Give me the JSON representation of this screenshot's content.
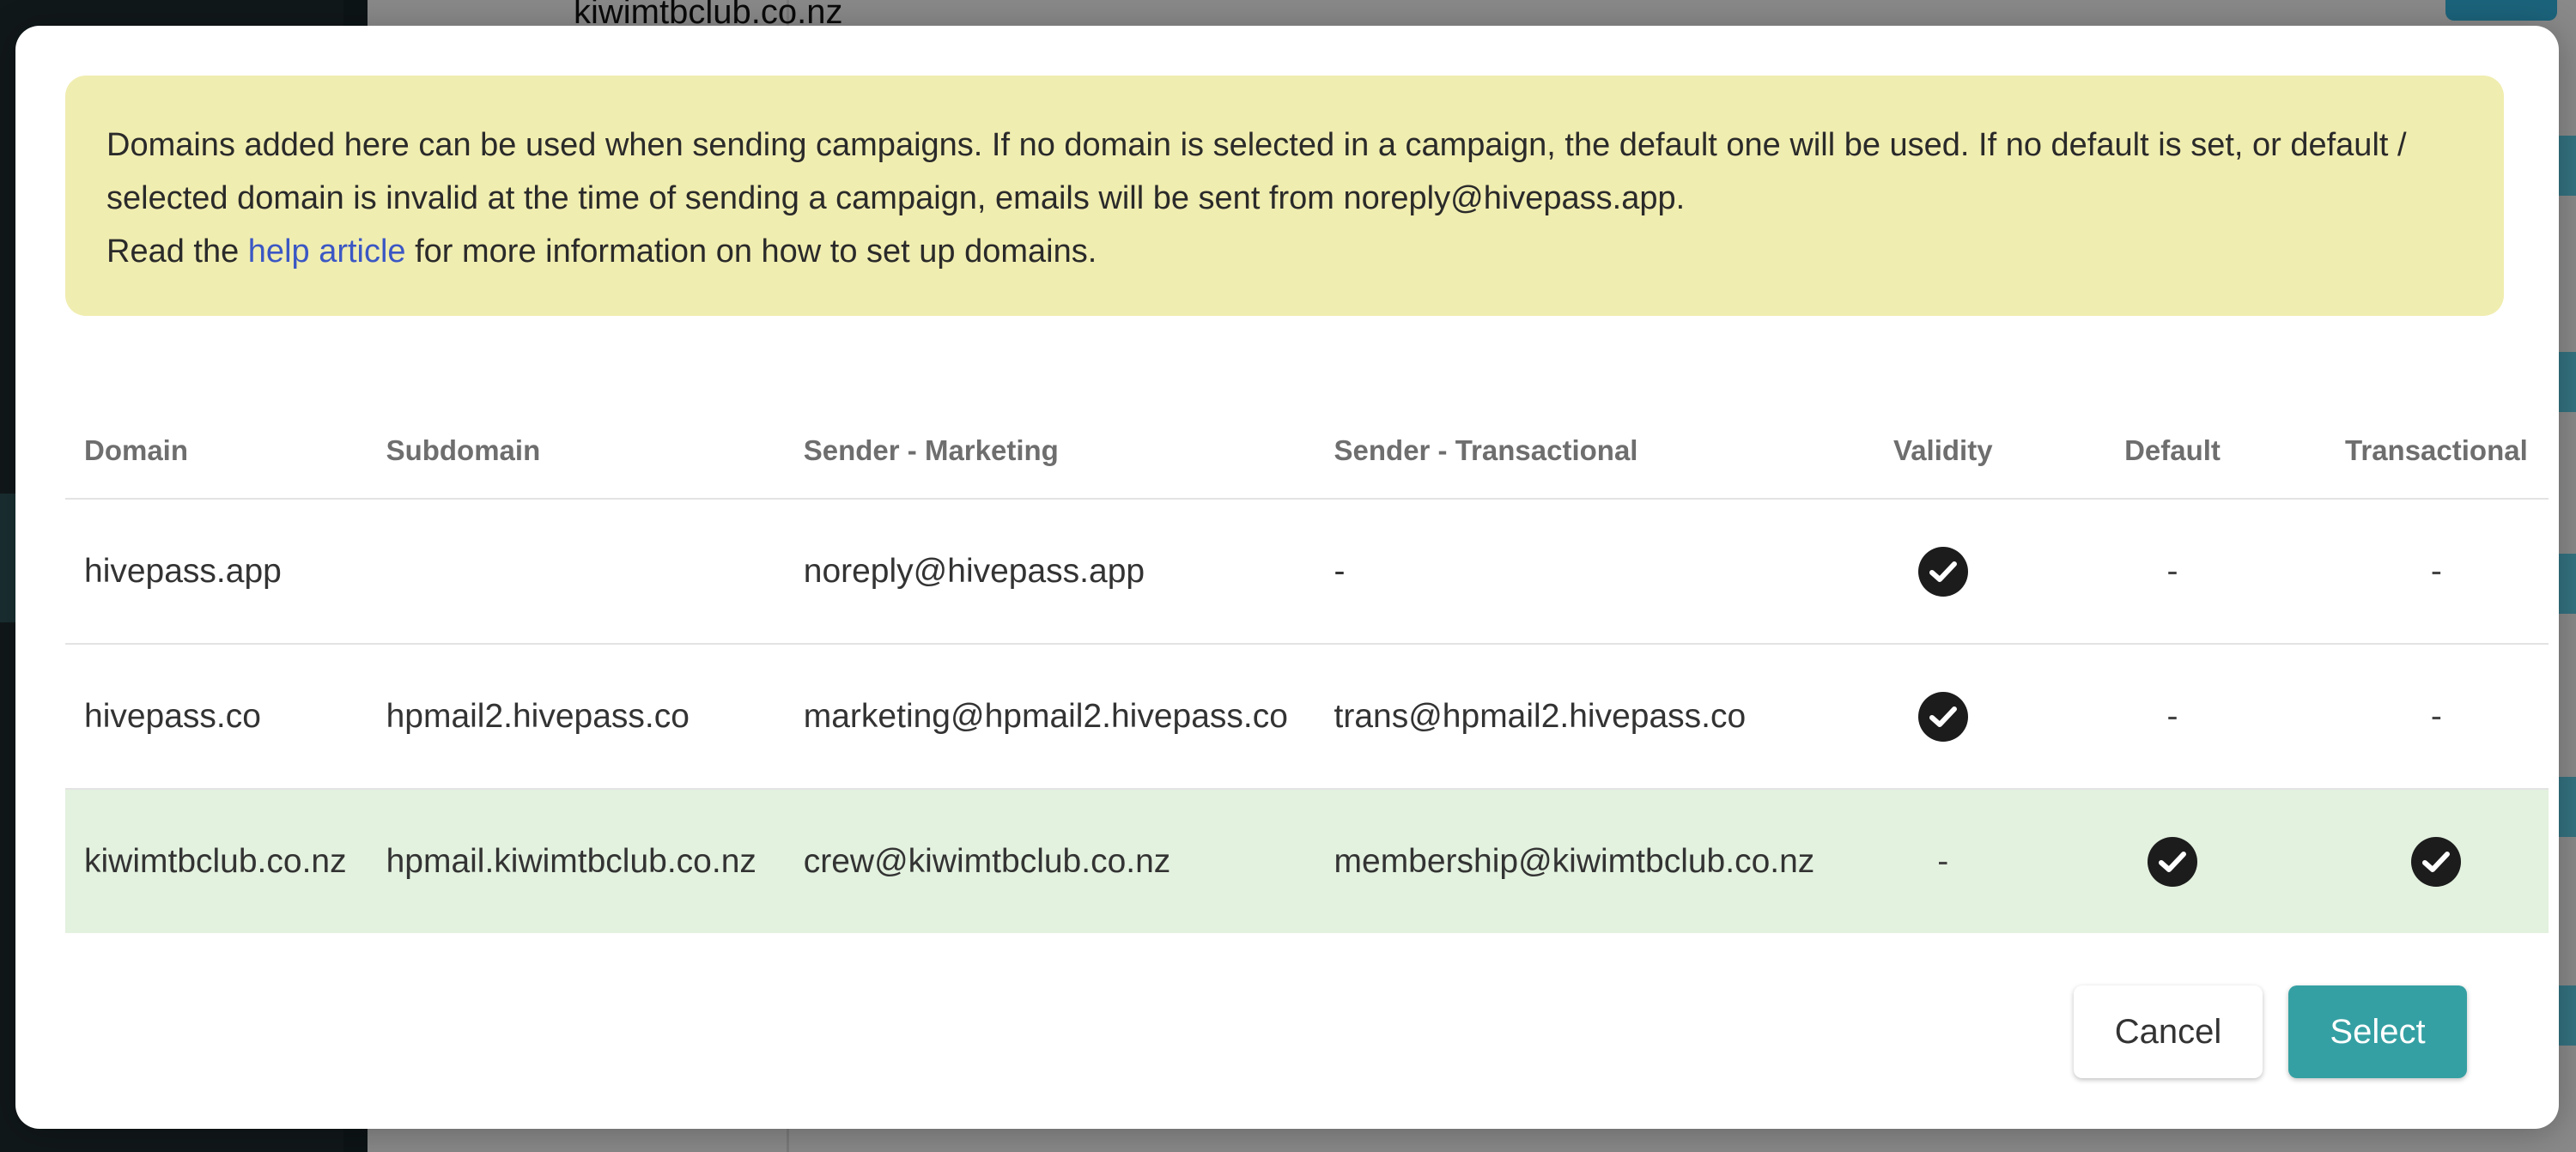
{
  "background": {
    "topbar_domain": "kiwimtbclub.co.nz"
  },
  "dialog": {
    "notice": {
      "text_part1": "Domains added here can be used when sending campaigns. If no domain is selected in a campaign, the default one will be used. If no default is set, or default / selected domain is invalid at the time of sending a campaign, emails will be sent from noreply@hivepass.app.",
      "text_part2": "Read the ",
      "link_text": "help article",
      "text_part3": " for more information on how to set up domains."
    },
    "table": {
      "columns": [
        "Domain",
        "Subdomain",
        "Sender - Marketing",
        "Sender - Transactional",
        "Validity",
        "Default",
        "Transactional"
      ],
      "rows": [
        {
          "domain": "hivepass.app",
          "subdomain": "",
          "sender_marketing": "noreply@hivepass.app",
          "sender_transactional": "-",
          "validity": true,
          "default": false,
          "transactional": false,
          "selected": false
        },
        {
          "domain": "hivepass.co",
          "subdomain": "hpmail2.hivepass.co",
          "sender_marketing": "marketing@hpmail2.hivepass.co",
          "sender_transactional": "trans@hpmail2.hivepass.co",
          "validity": true,
          "default": false,
          "transactional": false,
          "selected": false
        },
        {
          "domain": "kiwimtbclub.co.nz",
          "subdomain": "hpmail.kiwimtbclub.co.nz",
          "sender_marketing": "crew@kiwimtbclub.co.nz",
          "sender_transactional": "membership@kiwimtbclub.co.nz",
          "validity": false,
          "default": true,
          "transactional": true,
          "selected": true
        }
      ],
      "empty_marker": "-",
      "check_icon": "check-circle-icon"
    },
    "buttons": {
      "cancel_label": "Cancel",
      "select_label": "Select"
    }
  },
  "colors": {
    "notice_bg": "#f0edb0",
    "link": "#3b57c4",
    "selected_row": "#e3f1df",
    "primary_button": "#35a0a3"
  }
}
